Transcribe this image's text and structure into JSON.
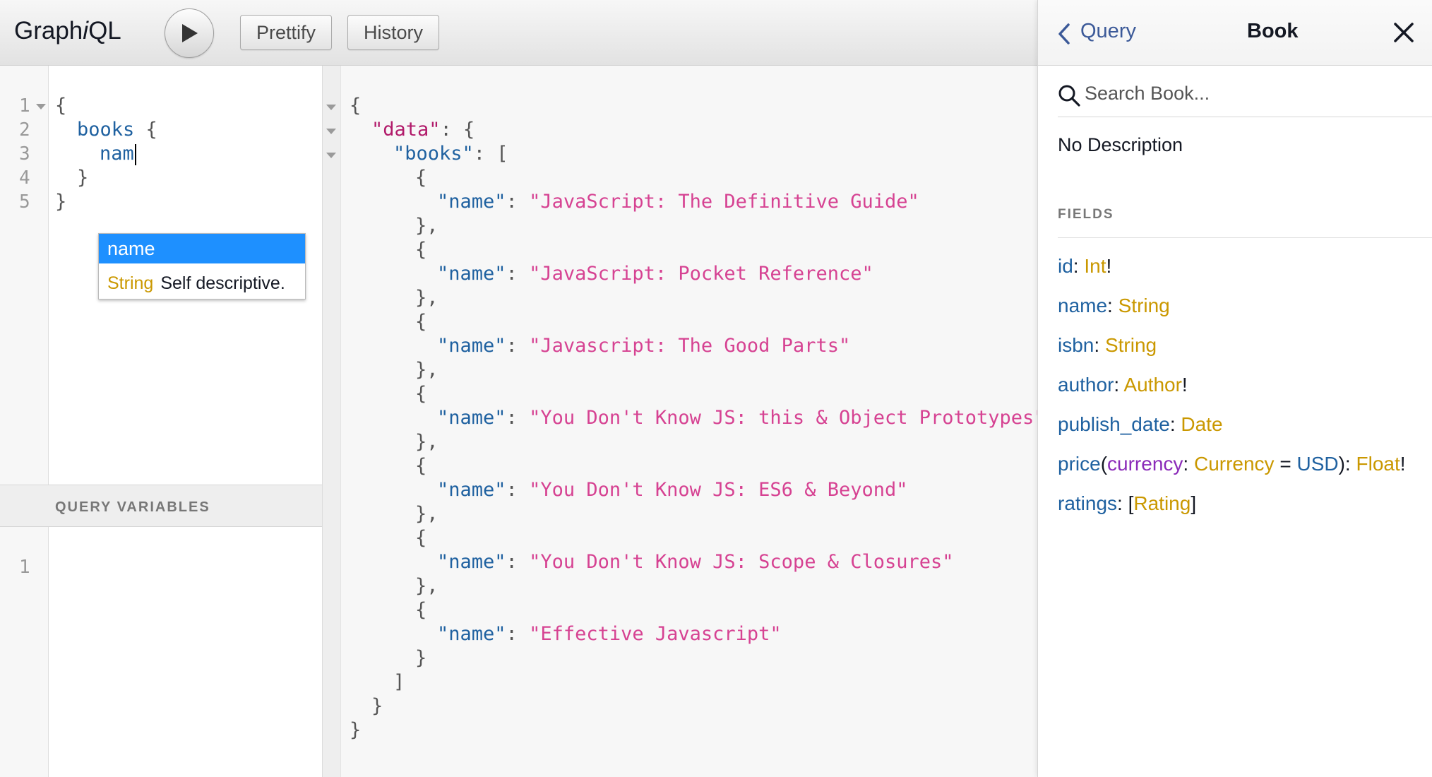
{
  "toolbar": {
    "logo_prefix": "Graph",
    "logo_i": "i",
    "logo_suffix": "QL",
    "run_icon": "play-icon",
    "prettify_label": "Prettify",
    "history_label": "History"
  },
  "query_editor": {
    "line_numbers": [
      "1",
      "2",
      "3",
      "4",
      "5"
    ],
    "lines": {
      "l1": "{",
      "l2_field": "books",
      "l2_brace": "{",
      "l3_typed": "nam",
      "l4": "}",
      "l5": "}"
    },
    "autocomplete": {
      "suggestion": "name",
      "type": "String",
      "description": "Self descriptive."
    }
  },
  "variables": {
    "title": "QUERY VARIABLES",
    "line_numbers": [
      "1"
    ]
  },
  "result": {
    "open_brace": "{",
    "data_key": "\"data\"",
    "books_key": "\"books\"",
    "name_key": "\"name\"",
    "books": [
      "\"JavaScript: The Definitive Guide\"",
      "\"JavaScript: Pocket Reference\"",
      "\"Javascript: The Good Parts\"",
      "\"You Don't Know JS: this & Object Prototypes\"",
      "\"You Don't Know JS: ES6 & Beyond\"",
      "\"You Don't Know JS: Scope & Closures\"",
      "\"Effective Javascript\""
    ]
  },
  "docs": {
    "back_label": "Query",
    "title": "Book",
    "search_placeholder": "Search Book...",
    "description": "No Description",
    "fields_title": "FIELDS",
    "fields": [
      {
        "name": "id",
        "type": "Int",
        "suffix": "!"
      },
      {
        "name": "name",
        "type": "String",
        "suffix": ""
      },
      {
        "name": "isbn",
        "type": "String",
        "suffix": ""
      },
      {
        "name": "author",
        "type": "Author",
        "suffix": "!"
      },
      {
        "name": "publish_date",
        "type": "Date",
        "suffix": ""
      },
      {
        "name": "ratings",
        "type": "Rating",
        "suffix": ""
      }
    ],
    "price_field": {
      "name": "price",
      "arg_name": "currency",
      "arg_type": "Currency",
      "default_value": "USD",
      "type": "Float",
      "suffix": "!"
    }
  },
  "colors": {
    "field": "#1f61a0",
    "type": "#ca9800",
    "string": "#d64292",
    "arg": "#8b2bb9",
    "accent": "#1e90ff"
  }
}
